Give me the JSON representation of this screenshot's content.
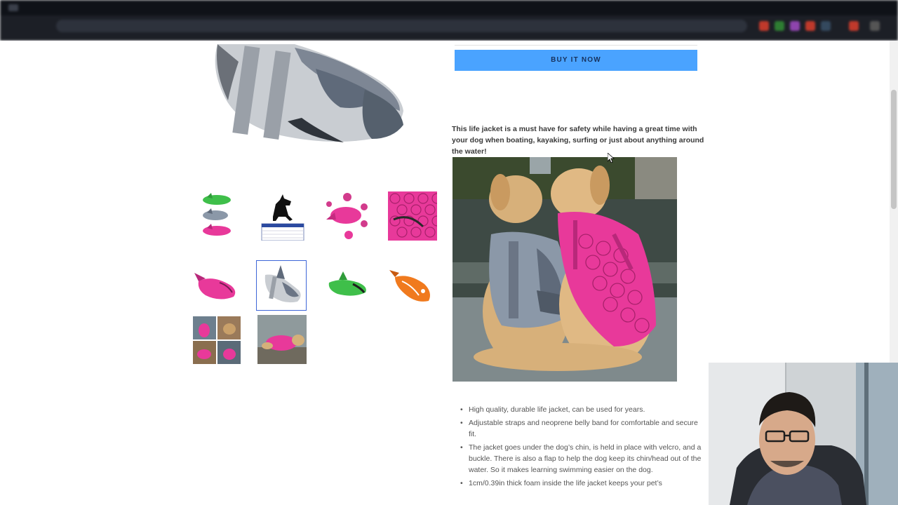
{
  "product": {
    "buy_button_label": "BUY IT NOW",
    "lead_text": "This life jacket is a must have for safety while having a great time with your dog when boating, kayaking, surfing or just about anything around the water!",
    "features": [
      "High quality, durable life jacket, can be used for years.",
      "Adjustable straps and neoprene belly band for comfortable and secure fit.",
      "The jacket goes under the dog’s chin, is held in place with velcro, and a buckle. There is also a flap to help the dog keep its chin/head out of the water. So it makes learning swimming easier on the dog.",
      "1cm/0.39in thick foam inside the life jacket keeps your pet’s"
    ]
  },
  "gallery": {
    "thumbnails": [
      {
        "name": "thumb-color-variants"
      },
      {
        "name": "thumb-size-chart"
      },
      {
        "name": "thumb-pink-features"
      },
      {
        "name": "thumb-pink-fabric"
      },
      {
        "name": "thumb-pink-jacket"
      },
      {
        "name": "thumb-grey-shark-jacket",
        "selected": true
      },
      {
        "name": "thumb-green-jacket"
      },
      {
        "name": "thumb-orange-fish-jacket"
      },
      {
        "name": "thumb-dogs-collage"
      },
      {
        "name": "thumb-dog-lying-pink"
      }
    ],
    "selected_index": 5
  },
  "colors": {
    "buy_button_bg": "#4aa3ff",
    "selected_thumb_border": "#3e66d8",
    "pink_jacket": "#e8399a",
    "grey_jacket": "#8b98a8",
    "green_jacket": "#3fbf4a",
    "orange_jacket": "#f07a1e"
  }
}
